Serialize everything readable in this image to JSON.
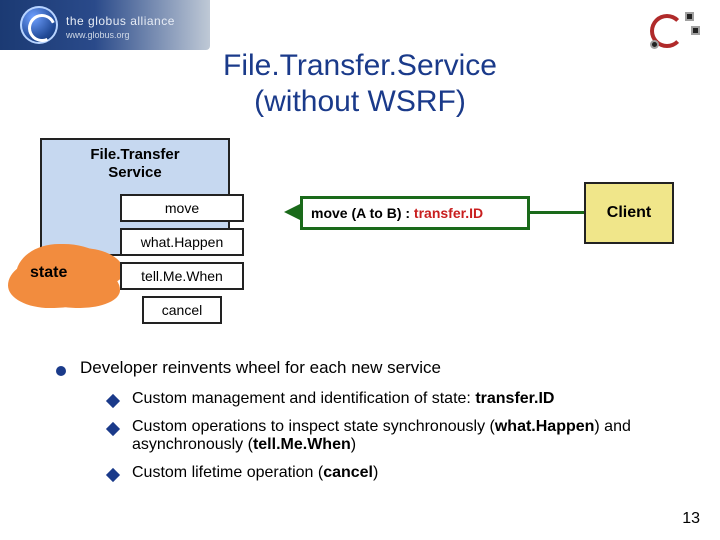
{
  "header": {
    "logo_text": "the globus alliance",
    "logo_url": "www.globus.org"
  },
  "title_line1": "File.Transfer.Service",
  "title_line2": "(without WSRF)",
  "diagram": {
    "service_caption_line1": "File.Transfer",
    "service_caption_line2": "Service",
    "state_label": "state",
    "ops": {
      "move": "move",
      "whatHappen": "what.Happen",
      "tellMeWhen": "tell.Me.When",
      "cancel": "cancel"
    },
    "message_prefix": "move (A to B) : ",
    "message_return": "transfer.ID",
    "client": "Client"
  },
  "bullets": {
    "main": "Developer reinvents wheel for each new service",
    "sub1_a": "Custom management and identification of state: ",
    "sub1_b": "transfer.ID",
    "sub2_a": "Custom operations to inspect state synchronously (",
    "sub2_b": "what.Happen",
    "sub2_c": ") and asynchronously (",
    "sub2_d": "tell.Me.When",
    "sub2_e": ")",
    "sub3_a": "Custom lifetime operation (",
    "sub3_b": "cancel",
    "sub3_c": ")"
  },
  "pagenum": "13"
}
